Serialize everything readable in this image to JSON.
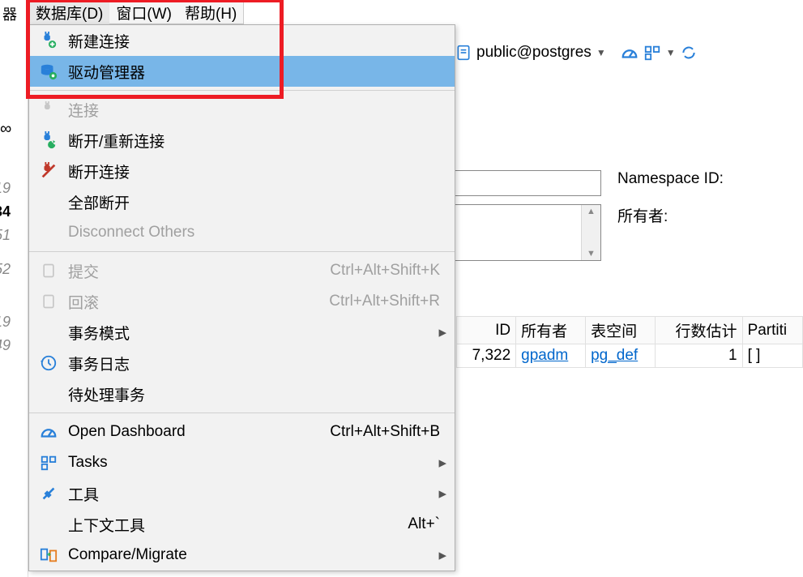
{
  "menubar": {
    "items": [
      {
        "label": "数据库(D)"
      },
      {
        "label": "窗口(W)"
      },
      {
        "label": "帮助(H)"
      }
    ]
  },
  "left_partial": {
    "cut0": "器",
    "cut1": "19",
    "cut2": "34",
    "cut3": "51",
    "cut4": "52",
    "cut5": "19",
    "cut6": "49"
  },
  "dropdown": {
    "items": [
      {
        "icon": "plug-add-icon",
        "label": "新建连接",
        "shortcut": "",
        "submenu": false,
        "disabled": false
      },
      {
        "icon": "db-gear-icon",
        "label": "驱动管理器",
        "shortcut": "",
        "submenu": false,
        "disabled": false,
        "highlighted": true
      },
      {
        "sep": true
      },
      {
        "icon": "plug-icon",
        "label": "连接",
        "shortcut": "",
        "submenu": false,
        "disabled": true
      },
      {
        "icon": "plug-refresh-icon",
        "label": "断开/重新连接",
        "shortcut": "",
        "submenu": false,
        "disabled": false
      },
      {
        "icon": "plug-off-icon",
        "label": "断开连接",
        "shortcut": "",
        "submenu": false,
        "disabled": false
      },
      {
        "icon": "",
        "label": "全部断开",
        "shortcut": "",
        "submenu": false,
        "disabled": false
      },
      {
        "icon": "disconnect-others-icon",
        "label": "Disconnect Others",
        "shortcut": "",
        "submenu": false,
        "disabled": true
      },
      {
        "sep": true
      },
      {
        "icon": "commit-icon",
        "label": "提交",
        "shortcut": "Ctrl+Alt+Shift+K",
        "submenu": false,
        "disabled": true
      },
      {
        "icon": "rollback-icon",
        "label": "回滚",
        "shortcut": "Ctrl+Alt+Shift+R",
        "submenu": false,
        "disabled": true
      },
      {
        "icon": "",
        "label": "事务模式",
        "shortcut": "",
        "submenu": true,
        "disabled": false
      },
      {
        "icon": "history-icon",
        "label": "事务日志",
        "shortcut": "",
        "submenu": false,
        "disabled": false
      },
      {
        "icon": "",
        "label": "待处理事务",
        "shortcut": "",
        "submenu": false,
        "disabled": false
      },
      {
        "sep": true
      },
      {
        "icon": "dashboard-icon",
        "label": "Open Dashboard",
        "shortcut": "Ctrl+Alt+Shift+B",
        "submenu": false,
        "disabled": false
      },
      {
        "icon": "tasks-icon",
        "label": "Tasks",
        "shortcut": "",
        "submenu": true,
        "disabled": false
      },
      {
        "icon": "tools-icon",
        "label": "工具",
        "shortcut": "",
        "submenu": true,
        "disabled": false
      },
      {
        "icon": "",
        "label": "上下文工具",
        "shortcut": "Alt+`",
        "submenu": false,
        "disabled": false
      },
      {
        "icon": "compare-icon",
        "label": "Compare/Migrate",
        "shortcut": "",
        "submenu": true,
        "disabled": false
      }
    ]
  },
  "schema_bar": {
    "label": "public@postgres"
  },
  "form": {
    "namespace_label": "Namespace ID:",
    "owner_label": "所有者:"
  },
  "table": {
    "headers": [
      "ID",
      "所有者",
      "表空间",
      "行数估计",
      "Partiti"
    ],
    "row": {
      "id": "7,322",
      "owner": "gpadm",
      "tablespace": "pg_def",
      "rowcount": "1",
      "partition": "[  ]"
    }
  }
}
